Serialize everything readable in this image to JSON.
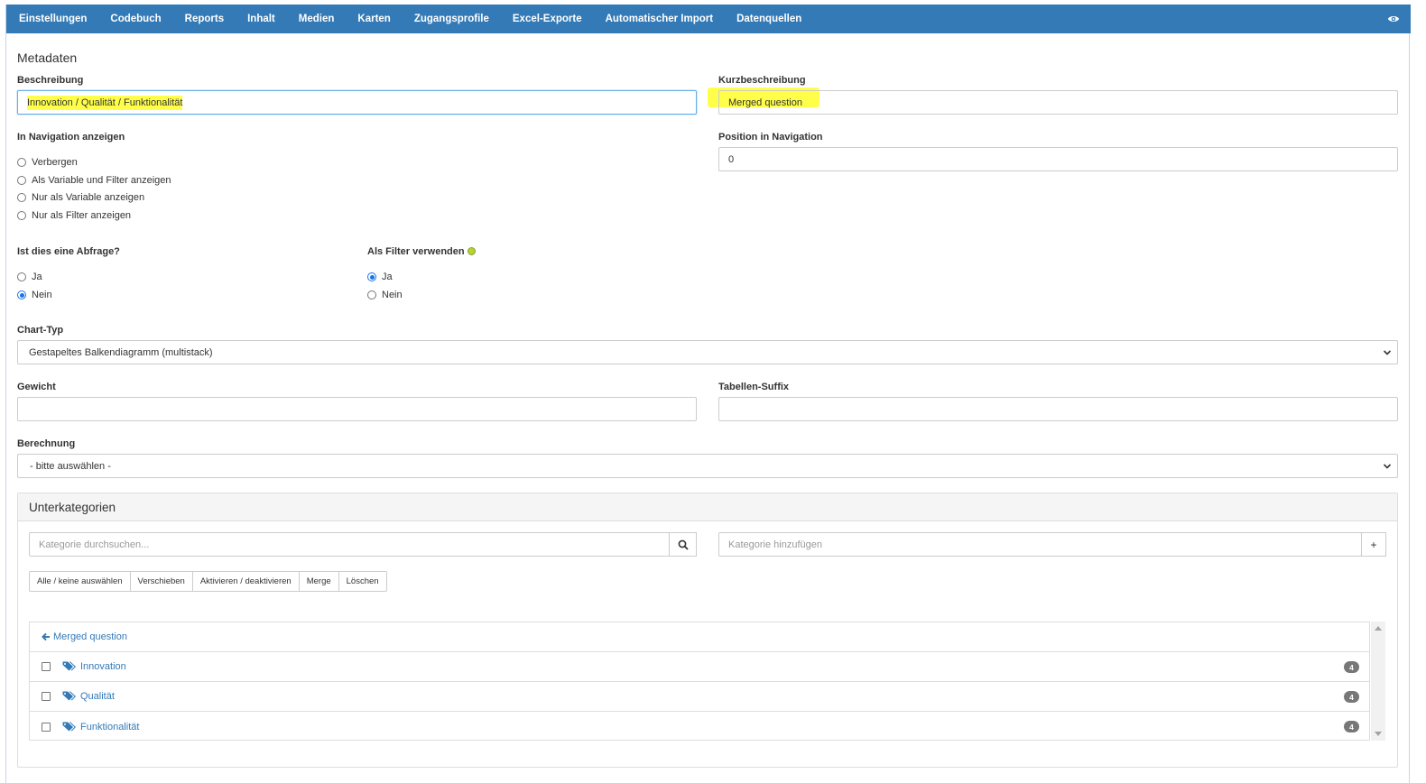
{
  "nav": {
    "items": [
      "Einstellungen",
      "Codebuch",
      "Reports",
      "Inhalt",
      "Medien",
      "Karten",
      "Zugangsprofile",
      "Excel-Exporte",
      "Automatischer Import",
      "Datenquellen"
    ],
    "eye_icon": "eye-icon"
  },
  "metadata": {
    "title": "Metadaten",
    "beschreibung_label": "Beschreibung",
    "beschreibung_value": "Innovation / Qualität / Funktionalität",
    "kurz_label": "Kurzbeschreibung",
    "kurz_value": "Merged question",
    "nav_label": "In Navigation anzeigen",
    "nav_options": [
      "Verbergen",
      "Als Variable und Filter anzeigen",
      "Nur als Variable anzeigen",
      "Nur als Filter anzeigen"
    ],
    "pos_label": "Position in Navigation",
    "pos_value": "0",
    "abfrage_label": "Ist dies eine Abfrage?",
    "abfrage_options": [
      "Ja",
      "Nein"
    ],
    "abfrage_selected": "Nein",
    "filter_label": "Als Filter verwenden",
    "filter_options": [
      "Ja",
      "Nein"
    ],
    "filter_selected": "Ja",
    "chart_label": "Chart-Typ",
    "chart_value": "Gestapeltes Balkendiagramm (multistack)",
    "gewicht_label": "Gewicht",
    "gewicht_value": "",
    "suffix_label": "Tabellen-Suffix",
    "suffix_value": "",
    "berechnung_label": "Berechnung",
    "berechnung_value": "- bitte auswählen -"
  },
  "sub": {
    "title": "Unterkategorien",
    "search_placeholder": "Kategorie durchsuchen...",
    "add_placeholder": "Kategorie hinzufügen",
    "add_symbol": "+",
    "buttons": [
      "Alle / keine auswählen",
      "Verschieben",
      "Aktivieren / deaktivieren",
      "Merge",
      "Löschen"
    ],
    "back_link": "Merged question",
    "rows": [
      {
        "label": "Innovation",
        "count": "4"
      },
      {
        "label": "Qualität",
        "count": "4"
      },
      {
        "label": "Funktionalität",
        "count": "4"
      }
    ]
  },
  "colors": {
    "navbar": "#337ab7",
    "highlight": "#ffff4a",
    "link": "#337ab7",
    "badge": "#777777"
  }
}
